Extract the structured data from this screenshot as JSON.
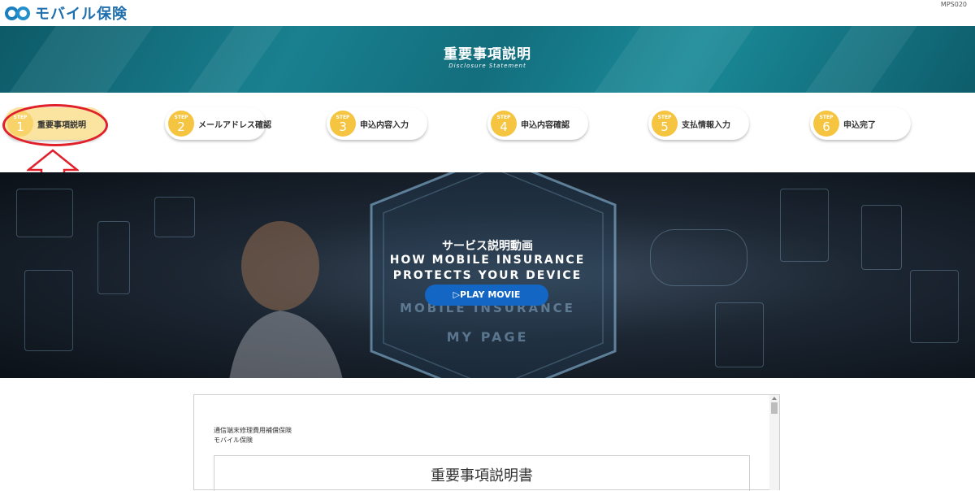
{
  "header": {
    "brand": "モバイル保険",
    "screen_code": "MPS020"
  },
  "title_band": {
    "title": "重要事項説明",
    "subtitle": "Disclosure Statement"
  },
  "steps": [
    {
      "label": "STEP",
      "number": "1",
      "text": "重要事項説明",
      "active": true
    },
    {
      "label": "STEP",
      "number": "2",
      "text": "メールアドレス確認",
      "active": false
    },
    {
      "label": "STEP",
      "number": "3",
      "text": "申込内容入力",
      "active": false
    },
    {
      "label": "STEP",
      "number": "4",
      "text": "申込内容確認",
      "active": false
    },
    {
      "label": "STEP",
      "number": "5",
      "text": "支払情報入力",
      "active": false
    },
    {
      "label": "STEP",
      "number": "6",
      "text": "申込完了",
      "active": false
    }
  ],
  "hero": {
    "jp_title": "サービス説明動画",
    "en_line1": "HOW MOBILE INSURANCE",
    "en_line2": "PROTECTS YOUR DEVICE",
    "play_button": "▷PLAY MOVIE",
    "ghost_text1": "MOBILE INSURANCE",
    "ghost_text2": "MY PAGE"
  },
  "document": {
    "line1": "通信端末修理費用補償保険",
    "line2": "モバイル保険",
    "heading": "重要事項説明書"
  },
  "colors": {
    "brand_blue": "#1f6fae",
    "teal_band": "#19808f",
    "step_yellow": "#f5c542",
    "highlight_red": "#e0202a",
    "play_blue": "#1366c4"
  }
}
